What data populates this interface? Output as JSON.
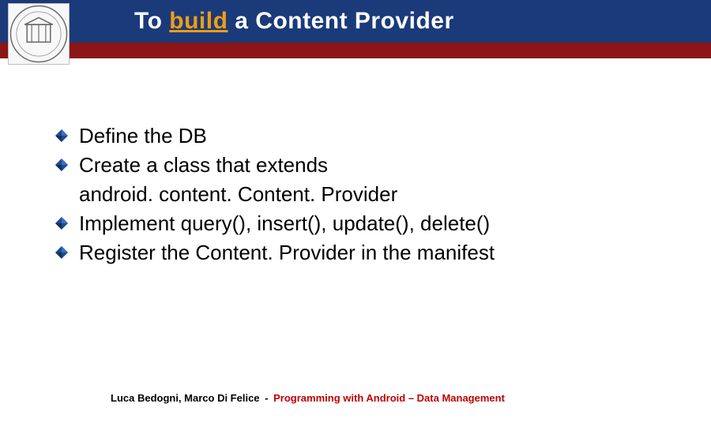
{
  "title": {
    "pre": "To ",
    "highlight": "build",
    "post": " a Content Provider"
  },
  "bullets": [
    {
      "text": "Define the DB"
    },
    {
      "text": "Create a class that extends"
    },
    {
      "cont": "android. content. Content. Provider"
    },
    {
      "text": "Implement query(), insert(), update(), delete()"
    },
    {
      "text": "Register the Content. Provider in the manifest"
    }
  ],
  "footer": {
    "authors": "Luca Bedogni, Marco Di Felice",
    "sep": "-",
    "course": "Programming with Android – Data Management"
  },
  "icons": {
    "bullet": "diamond-bullet-icon",
    "seal": "university-seal-icon"
  }
}
